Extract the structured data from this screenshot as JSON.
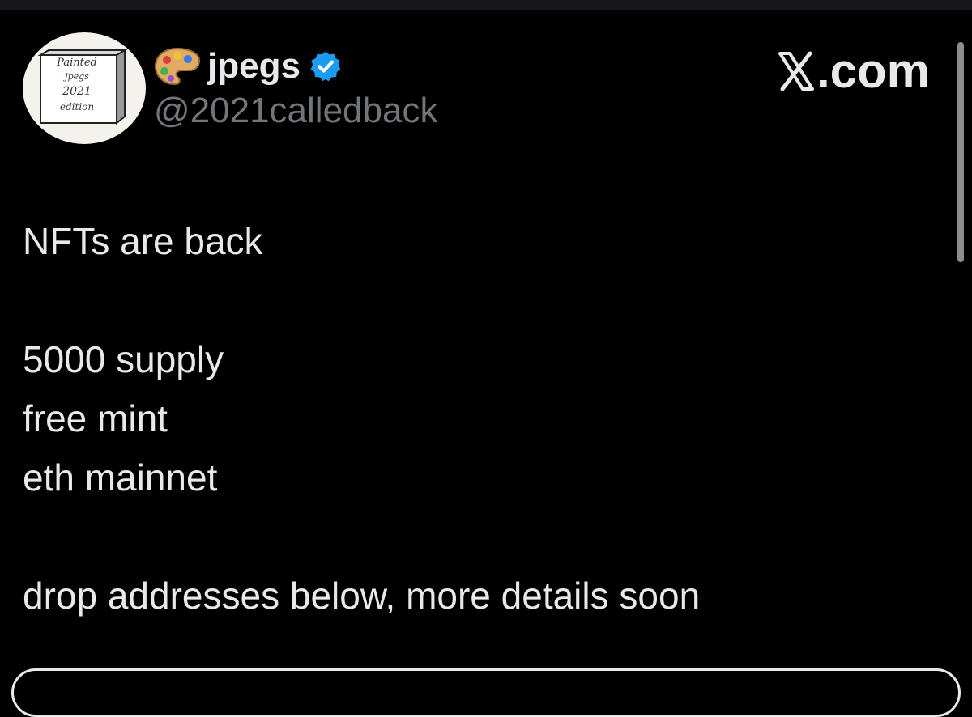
{
  "post": {
    "author": {
      "name": "jpegs",
      "handle": "@2021calledback",
      "avatar_text": [
        "Painted",
        "jpegs",
        "2021",
        "edition"
      ],
      "name_emoji_icon": "artist-palette-icon",
      "verified_icon": "verified-badge-icon"
    },
    "source": {
      "brand_text": ".com",
      "brand_icon": "x-logo-icon"
    },
    "lines": [
      "NFTs are back",
      "",
      "5000 supply",
      "free mint",
      "eth mainnet",
      "",
      "drop addresses below, more details soon"
    ]
  },
  "colors": {
    "background": "#000000",
    "text": "#e7e9ea",
    "handle": "#71767b",
    "verified": "#1d9bf0",
    "scrollbar": "#8b8d90"
  }
}
